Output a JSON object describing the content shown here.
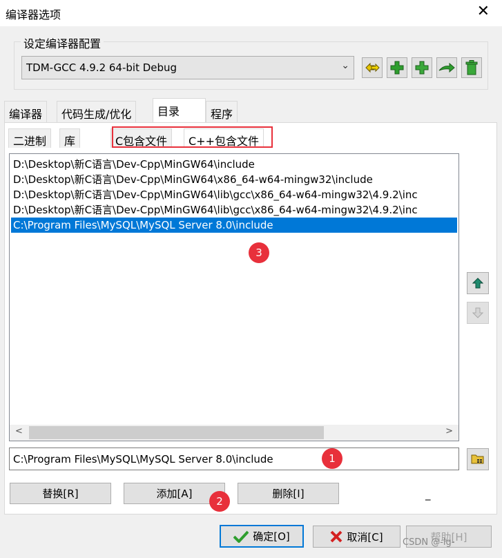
{
  "window": {
    "title": "编译器选项",
    "close_glyph": "✕"
  },
  "config_group": {
    "label": "设定编译器配置",
    "selected": "TDM-GCC 4.9.2 64-bit Debug",
    "toolbar_icons": [
      "copy-config-icon",
      "add-config-icon",
      "add-new-config-icon",
      "rename-config-icon",
      "delete-config-icon"
    ]
  },
  "tabs": [
    "编译器",
    "代码生成/优化",
    "目录",
    "程序"
  ],
  "active_tab": "目录",
  "subtabs": [
    "二进制",
    "库",
    "C包含文件",
    "C++包含文件"
  ],
  "active_subtab": "C++包含文件",
  "directories": [
    "D:\\Desktop\\新C语言\\Dev-Cpp\\MinGW64\\include",
    "D:\\Desktop\\新C语言\\Dev-Cpp\\MinGW64\\x86_64-w64-mingw32\\include",
    "D:\\Desktop\\新C语言\\Dev-Cpp\\MinGW64\\lib\\gcc\\x86_64-w64-mingw32\\4.9.2\\inc",
    "D:\\Desktop\\新C语言\\Dev-Cpp\\MinGW64\\lib\\gcc\\x86_64-w64-mingw32\\4.9.2\\inc",
    "C:\\Program Files\\MySQL\\MySQL Server 8.0\\include"
  ],
  "selected_index": 4,
  "path_value": "C:\\Program Files\\MySQL\\MySQL Server 8.0\\include",
  "buttons": {
    "replace": "替换[R]",
    "add": "添加[A]",
    "delete": "删除[I]",
    "ok": "确定[O]",
    "cancel": "取消[C]",
    "help": "帮助[H]"
  },
  "minimize_glyph": "_",
  "annotations": [
    "1",
    "2",
    "3"
  ],
  "watermark": "CSDN @-lg-",
  "colors": {
    "selection": "#0078d7",
    "annotation_red": "#e8303b",
    "icon_green": "#2e9e2e"
  }
}
